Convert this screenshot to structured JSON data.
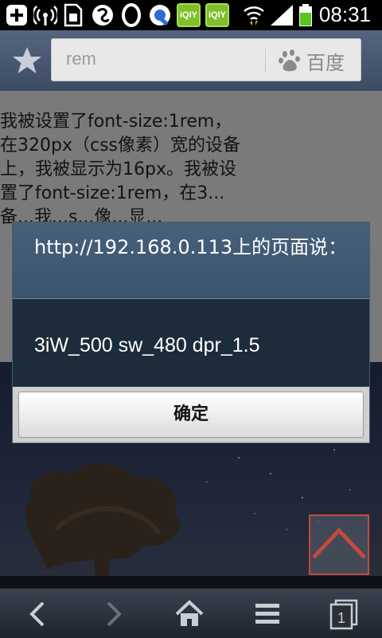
{
  "status_bar": {
    "time": "08:31",
    "icons": [
      "plus-icon",
      "wifi-broadcast-icon",
      "sim-icon",
      "app-icon",
      "circle-app-icon",
      "q-app-icon",
      "qiyi-icon",
      "qiyi-icon",
      "wifi-icon",
      "signal-icon",
      "battery-icon"
    ],
    "qiyi_label": "iQIY"
  },
  "address_bar": {
    "url": "rem",
    "search_engine_label": "百度"
  },
  "page": {
    "text": "我被设置了font-size:1rem，在320px（css像素）宽的设备上，我被显示为16px。我被设置了font-size:1rem，在3⁠...备...我...s...像...显..."
  },
  "dialog": {
    "title": "http://192.168.0.113上的页面说：",
    "message": "3iW_500  sw_480  dpr_1.5",
    "ok_label": "确定"
  },
  "colors": {
    "status_bar_bg": "#000000",
    "toolbar_bg": "#4a5b73",
    "dialog_title_bg": "#42596f",
    "dialog_body_bg": "#1d2c3b",
    "accent_red": "#c24a3d"
  }
}
